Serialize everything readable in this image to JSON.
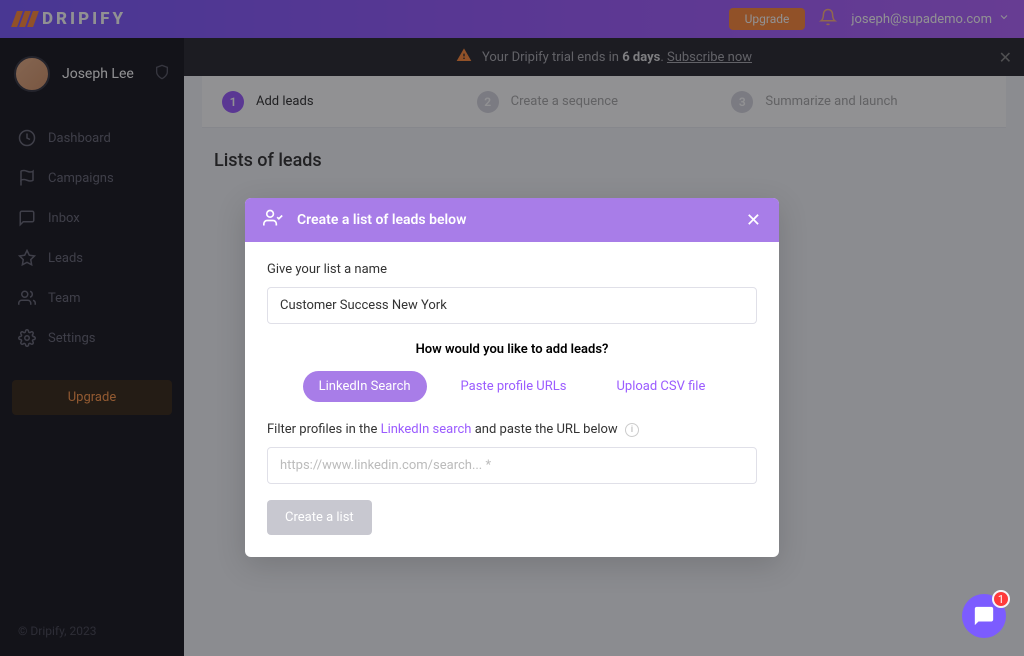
{
  "header": {
    "brand": "DRIPIFY",
    "upgrade_label": "Upgrade",
    "user_email": "joseph@supademo.com"
  },
  "sidebar": {
    "username": "Joseph Lee",
    "nav": [
      {
        "label": "Dashboard"
      },
      {
        "label": "Campaigns"
      },
      {
        "label": "Inbox"
      },
      {
        "label": "Leads"
      },
      {
        "label": "Team"
      },
      {
        "label": "Settings"
      }
    ],
    "upgrade_label": "Upgrade",
    "footer": "© Dripify, 2023"
  },
  "banner": {
    "prefix": "Your Dripify trial ends in ",
    "days": "6 days",
    "suffix": ". ",
    "link": "Subscribe now"
  },
  "stepper": {
    "steps": [
      {
        "num": "1",
        "label": "Add leads"
      },
      {
        "num": "2",
        "label": "Create a sequence"
      },
      {
        "num": "3",
        "label": "Summarize and launch"
      }
    ]
  },
  "page": {
    "title": "Lists of leads"
  },
  "modal": {
    "title": "Create a list of leads below",
    "name_label": "Give your list a name",
    "name_value": "Customer Success New York",
    "how_label": "How would you like to add leads?",
    "tabs": [
      {
        "label": "LinkedIn Search"
      },
      {
        "label": "Paste profile URLs"
      },
      {
        "label": "Upload CSV file"
      }
    ],
    "filter_prefix": "Filter profiles in the ",
    "filter_link": "LinkedIn search",
    "filter_suffix": " and paste the URL below",
    "url_placeholder": "https://www.linkedin.com/search... *",
    "create_label": "Create a list"
  },
  "chat": {
    "badge": "1"
  }
}
